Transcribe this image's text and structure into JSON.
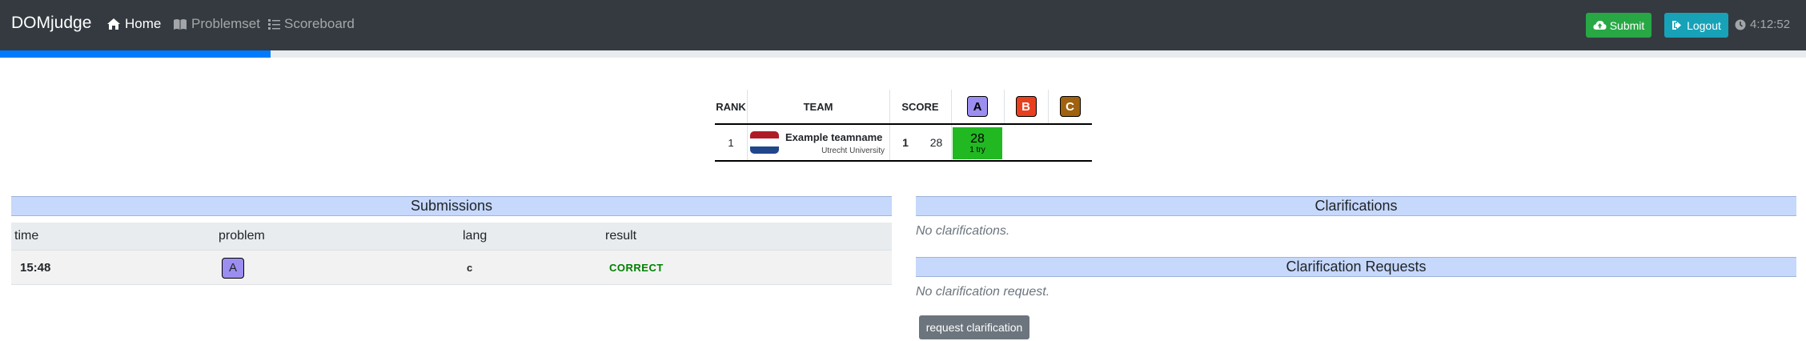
{
  "navbar": {
    "brand": "DOMjudge",
    "items": [
      {
        "label": "Home",
        "icon": "home-icon",
        "active": true
      },
      {
        "label": "Problemset",
        "icon": "book-icon",
        "active": false
      },
      {
        "label": "Scoreboard",
        "icon": "list-icon",
        "active": false
      }
    ],
    "submit_label": "Submit",
    "logout_label": "Logout",
    "clock": "4:12:52"
  },
  "contest_progress": 0.15,
  "colors": {
    "navbar": "#343a40",
    "submit": "#28a745",
    "logout": "#17a2b8",
    "progress": "#007bff",
    "solved": "#22b822",
    "panel_header": "#c6d8fb",
    "correct": "#008000"
  },
  "scoreboard": {
    "headers": {
      "rank": "RANK",
      "team": "TEAM",
      "score": "SCORE"
    },
    "problems": [
      {
        "label": "A",
        "color": "#9b8ef0"
      },
      {
        "label": "B",
        "color": "#e8401f"
      },
      {
        "label": "C",
        "color": "#a0620f"
      }
    ],
    "rows": [
      {
        "rank": "1",
        "team_name": "Example teamname",
        "affiliation": "Utrecht University",
        "flag_colors": [
          "#ae1c28",
          "#ffffff",
          "#21468b"
        ],
        "solved": "1",
        "penalty": "28",
        "results": [
          {
            "time": "28",
            "tries": "1 try",
            "status": "solved"
          },
          {
            "time": "",
            "tries": "",
            "status": "none"
          },
          {
            "time": "",
            "tries": "",
            "status": "none"
          }
        ]
      }
    ]
  },
  "submissions": {
    "title": "Submissions",
    "columns": [
      "time",
      "problem",
      "lang",
      "result"
    ],
    "rows": [
      {
        "time": "15:48",
        "problem": "A",
        "problem_color": "#9b8ef0",
        "lang": "c",
        "result": "CORRECT"
      }
    ]
  },
  "clarifications": {
    "title": "Clarifications",
    "empty_text": "No clarifications."
  },
  "clarification_requests": {
    "title": "Clarification Requests",
    "empty_text": "No clarification request.",
    "button_label": "request clarification"
  }
}
